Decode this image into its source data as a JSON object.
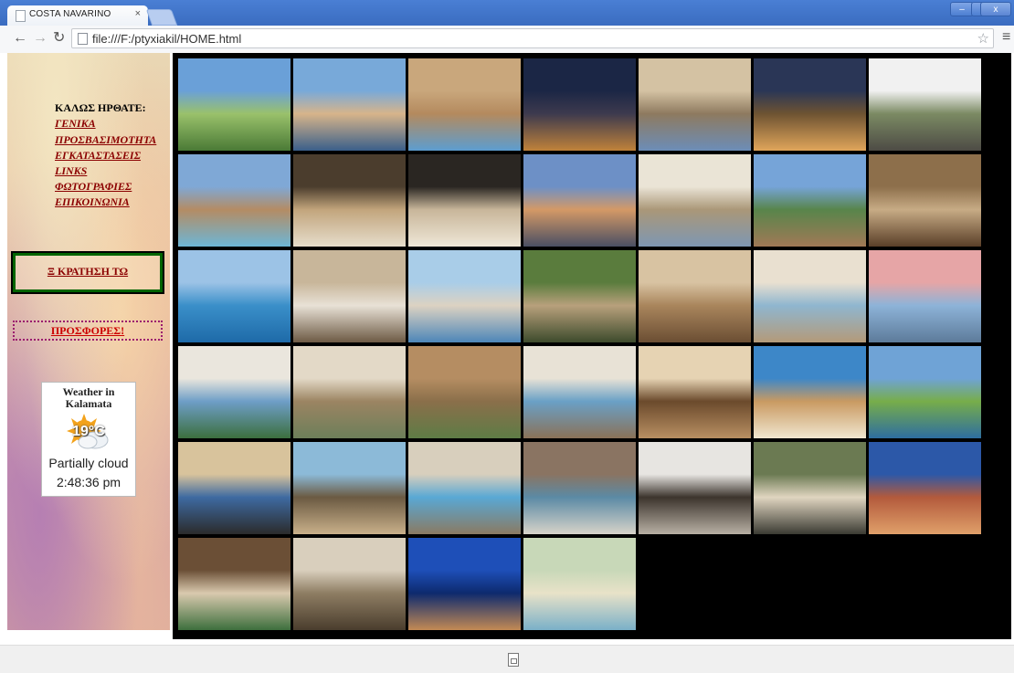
{
  "browser": {
    "tab_title": "COSTA NAVARINO",
    "tab_close": "×",
    "url": "file:///F:/ptyxiakil/HOME.html",
    "window_controls": [
      "–",
      "▫",
      "x"
    ]
  },
  "sidebar": {
    "welcome": "ΚΑΛΩΣ ΗΡΘΑΤΕ:",
    "links": [
      {
        "label": "ΓΕΝΙΚΑ"
      },
      {
        "label": "ΠΡΟΣΒΑΣΙΜΟΤΗΤΑ"
      },
      {
        "label": "ΕΓΚΑΤΑΣΤΑΣΕΙΣ"
      },
      {
        "label": "LINKS"
      },
      {
        "label": "ΦΩΤΟΓΡΑΦΙΕΣ"
      },
      {
        "label": "ΕΠΙΚΟΙΝΩΝΙΑ"
      }
    ],
    "booking": "Ξ ΚΡΑΤΗΣΗ ΤΩ",
    "offers": "ΠΡΟΣΦΟΡΕΣ!",
    "weather": {
      "title_line1": "Weather in",
      "title_line2": "Kalamata",
      "temperature": "19°C",
      "condition": "Partially cloud",
      "time": "2:48:36 pm",
      "icon": "sun-cloud-icon"
    }
  },
  "gallery": {
    "photos": [
      {
        "name": "golf-course-aerial",
        "colors": [
          "#6aa0d8",
          "#9ac16b",
          "#4a7a36"
        ]
      },
      {
        "name": "pool-terrace",
        "colors": [
          "#78a9d9",
          "#d7b48a",
          "#3a5f8a"
        ]
      },
      {
        "name": "stone-arches-pool",
        "colors": [
          "#c9a77c",
          "#b48a5e",
          "#5c9dd0"
        ]
      },
      {
        "name": "night-moon-resort",
        "colors": [
          "#1b2645",
          "#3d3a4e",
          "#c0823a"
        ]
      },
      {
        "name": "room-sea-view",
        "colors": [
          "#d4c2a3",
          "#8e7a5f",
          "#6c8db8"
        ]
      },
      {
        "name": "night-pavilion",
        "colors": [
          "#2a3656",
          "#6e5332",
          "#e0a55a"
        ]
      },
      {
        "name": "navarino-dunes-sign",
        "colors": [
          "#f1f1f1",
          "#7b8a63",
          "#4d4b45"
        ]
      },
      {
        "name": "stone-villa-pool",
        "colors": [
          "#7fa8d6",
          "#b48c64",
          "#6db6d6"
        ]
      },
      {
        "name": "banquet-arches",
        "colors": [
          "#4b3d2d",
          "#c2a57c",
          "#e6ddcc"
        ]
      },
      {
        "name": "event-hall",
        "colors": [
          "#2a2622",
          "#c8b69a",
          "#efe7d7"
        ]
      },
      {
        "name": "sunset-terrace",
        "colors": [
          "#6d90c6",
          "#d49966",
          "#4a4f63"
        ]
      },
      {
        "name": "bright-suite",
        "colors": [
          "#eae4d6",
          "#aa9778",
          "#7e97b3"
        ]
      },
      {
        "name": "sea-deck",
        "colors": [
          "#76a4d8",
          "#58854b",
          "#a17956"
        ]
      },
      {
        "name": "arched-lounge",
        "colors": [
          "#8d6f4b",
          "#c7ab85",
          "#5a3f28"
        ]
      },
      {
        "name": "infinity-pool",
        "colors": [
          "#9cc3e6",
          "#3a8fc9",
          "#1e6aa8"
        ]
      },
      {
        "name": "stone-bath",
        "colors": [
          "#c8b69a",
          "#e8e1d6",
          "#6d5a44"
        ]
      },
      {
        "name": "pool-cabana",
        "colors": [
          "#a9cde8",
          "#dcd2c2",
          "#4d86b8"
        ]
      },
      {
        "name": "garden-dining",
        "colors": [
          "#5a7c3d",
          "#b8a07c",
          "#3d4b2c"
        ]
      },
      {
        "name": "arched-restaurant",
        "colors": [
          "#d8c3a2",
          "#a9855c",
          "#6b4e33"
        ]
      },
      {
        "name": "colonnade-pool",
        "colors": [
          "#e9e0d0",
          "#8fb6cf",
          "#b49a79"
        ]
      },
      {
        "name": "sunset-pool",
        "colors": [
          "#e6a5a6",
          "#8db3d8",
          "#5d7b9a"
        ]
      },
      {
        "name": "ocean-bedroom",
        "colors": [
          "#eae6dd",
          "#6e9ec7",
          "#3c6f3e"
        ]
      },
      {
        "name": "loft-living",
        "colors": [
          "#e3d9c7",
          "#9b8462",
          "#6d7f5a"
        ]
      },
      {
        "name": "aerial-villas",
        "colors": [
          "#b58d62",
          "#8a6f4a",
          "#5e7c46"
        ]
      },
      {
        "name": "window-suite",
        "colors": [
          "#e8e2d6",
          "#6aa0c6",
          "#8a7258"
        ]
      },
      {
        "name": "warm-lounge",
        "colors": [
          "#e6d3b3",
          "#6b4a2c",
          "#b88f62"
        ]
      },
      {
        "name": "beach-pavilion",
        "colors": [
          "#3d87c8",
          "#c99a62",
          "#f0e6cf"
        ]
      },
      {
        "name": "golf-green-pool",
        "colors": [
          "#6fa3d6",
          "#77ad4a",
          "#2e6ea0"
        ]
      },
      {
        "name": "beach-loungers",
        "colors": [
          "#d8c39c",
          "#3e6aa1",
          "#2b2b2b"
        ]
      },
      {
        "name": "seaside-dining",
        "colors": [
          "#8cbad8",
          "#6b5a42",
          "#c9b08a"
        ]
      },
      {
        "name": "villa-plunge-pool",
        "colors": [
          "#d8cfbd",
          "#59a8d4",
          "#8a7a62"
        ]
      },
      {
        "name": "waterfall-spa",
        "colors": [
          "#8a7462",
          "#5b8aa5",
          "#d7d3c9"
        ]
      },
      {
        "name": "vanity-bathroom",
        "colors": [
          "#e7e5e1",
          "#3c342d",
          "#b8b0a4"
        ]
      },
      {
        "name": "bath-suite",
        "colors": [
          "#6b7a52",
          "#e0d5c0",
          "#3b3b33"
        ]
      },
      {
        "name": "dusk-terrace",
        "colors": [
          "#2c58a8",
          "#b35a3c",
          "#e0a06a"
        ]
      },
      {
        "name": "timber-dining",
        "colors": [
          "#6b4f36",
          "#d9c9ae",
          "#3d6f3d"
        ]
      },
      {
        "name": "grand-lobby",
        "colors": [
          "#d9cfbd",
          "#8e7d63",
          "#4a3d2d"
        ]
      },
      {
        "name": "blue-night-arch",
        "colors": [
          "#1e4fb8",
          "#0d2a6e",
          "#c38a54"
        ]
      },
      {
        "name": "kids-playroom",
        "colors": [
          "#c8d8b8",
          "#e8e2c8",
          "#7ab0c8"
        ]
      }
    ]
  }
}
